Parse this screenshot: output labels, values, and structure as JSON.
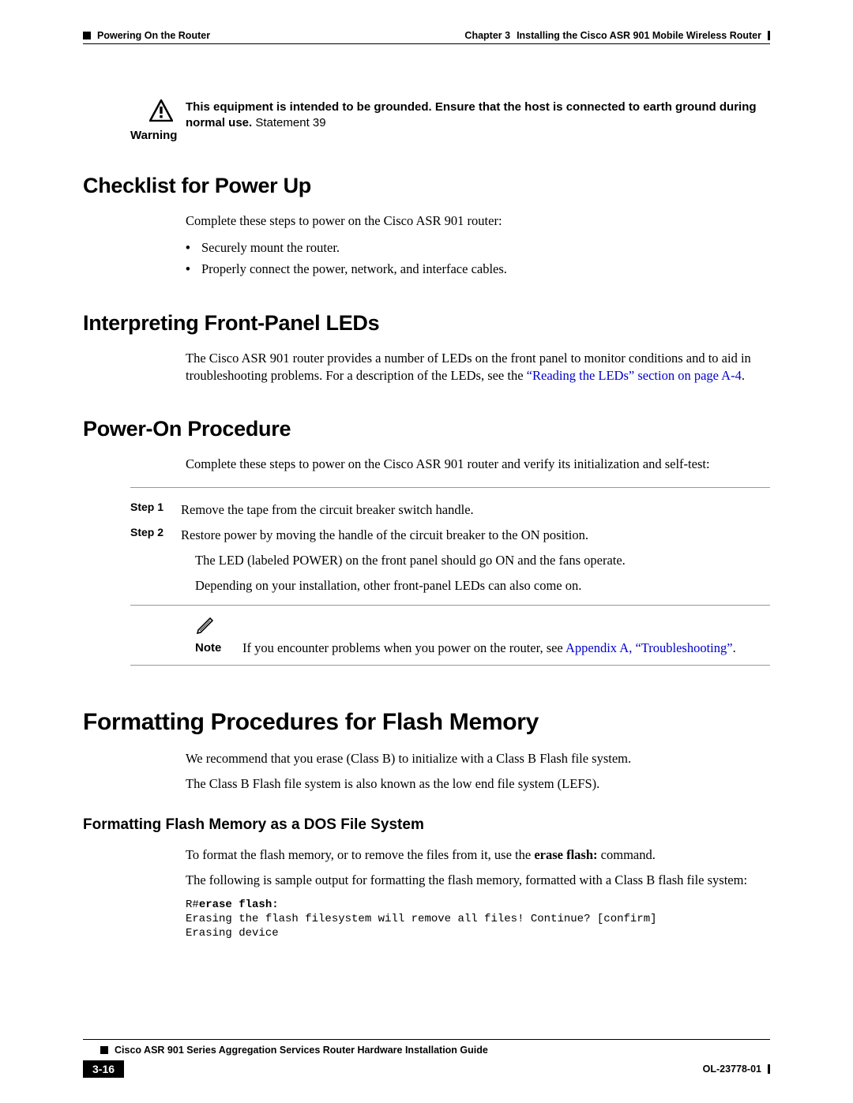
{
  "header": {
    "section_title": "Powering On the Router",
    "chapter_label": "Chapter 3",
    "chapter_title": "Installing the Cisco ASR 901 Mobile Wireless Router"
  },
  "warning": {
    "label": "Warning",
    "text_bold": "This equipment is intended to be grounded. Ensure that the host is connected to earth ground during normal use.",
    "statement": " Statement 39"
  },
  "section_checklist": {
    "heading": "Checklist for Power Up",
    "intro": "Complete these steps to power on the Cisco ASR 901 router:",
    "bullets": [
      "Securely mount the router.",
      "Properly connect the power, network, and interface cables."
    ]
  },
  "section_leds": {
    "heading": "Interpreting Front-Panel LEDs",
    "body_pre": "The Cisco ASR 901 router provides a number of LEDs on the front panel to monitor conditions and to aid in troubleshooting problems. For a description of the LEDs, see the ",
    "link": "“Reading the LEDs” section on page A-4",
    "body_post": "."
  },
  "section_poweron": {
    "heading": "Power-On Procedure",
    "intro": "Complete these steps to power on the Cisco ASR 901 router and verify its initialization and self-test:",
    "steps": [
      {
        "label": "Step 1",
        "text": "Remove the tape from the circuit breaker switch handle."
      },
      {
        "label": "Step 2",
        "text": "Restore power by moving the handle of the circuit breaker to the ON position."
      }
    ],
    "extras": [
      "The LED (labeled POWER) on the front panel should go ON and the fans operate.",
      "Depending on your installation, other front-panel LEDs can also come on."
    ],
    "note": {
      "label": "Note",
      "text_pre": "If you encounter problems when you power on the router, see ",
      "link": "Appendix A, “Troubleshooting”",
      "text_post": "."
    }
  },
  "section_flash": {
    "heading": "Formatting Procedures for Flash Memory",
    "p1": "We recommend that you erase (Class B) to initialize with a Class B Flash file system.",
    "p2": "The Class B Flash file system is also known as the low end file system (LEFS).",
    "sub_heading": "Formatting Flash Memory as a DOS File System",
    "sub_p1_pre": "To format the flash memory, or to remove the files from it, use the ",
    "sub_p1_cmd": "erase flash:",
    "sub_p1_post": " command.",
    "sub_p2": "The following is sample output for formatting the flash memory, formatted with a Class B flash file system:",
    "code_prompt": "R#",
    "code_cmd": "erase flash:",
    "code_line2": "Erasing the flash filesystem will remove all files! Continue? [confirm]",
    "code_line3": "Erasing device"
  },
  "footer": {
    "guide_title": "Cisco ASR 901 Series Aggregation Services Router Hardware Installation Guide",
    "page_num": "3-16",
    "doc_id": "OL-23778-01"
  }
}
